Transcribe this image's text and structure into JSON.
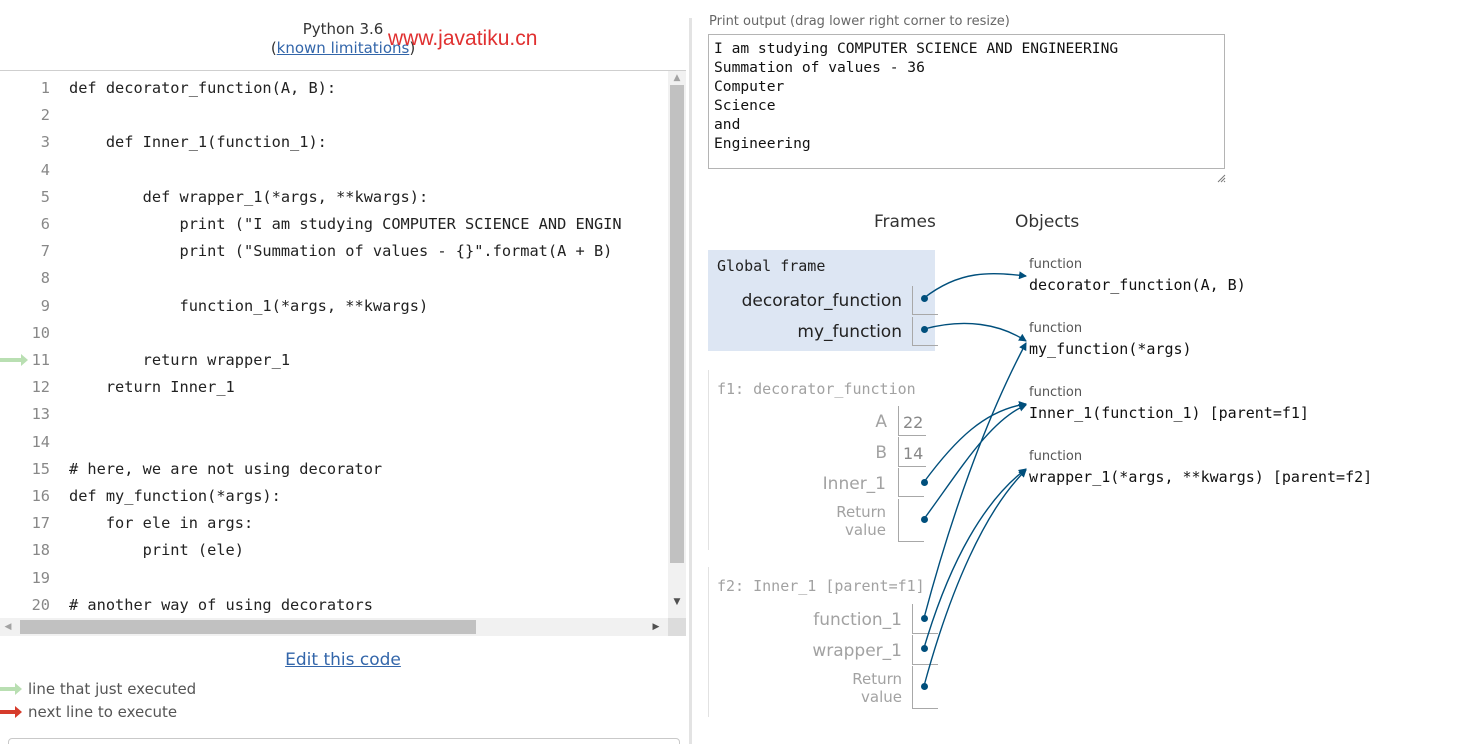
{
  "header": {
    "python_version": "Python 3.6",
    "limitations_open": "(",
    "limitations_link": "known limitations",
    "limitations_close": ")",
    "watermark": "www.javatiku.cn"
  },
  "code": {
    "lines": [
      {
        "num": "1",
        "text": "def decorator_function(A, B):"
      },
      {
        "num": "2",
        "text": ""
      },
      {
        "num": "3",
        "text": "    def Inner_1(function_1):"
      },
      {
        "num": "4",
        "text": ""
      },
      {
        "num": "5",
        "text": "        def wrapper_1(*args, **kwargs):"
      },
      {
        "num": "6",
        "text": "            print (\"I am studying COMPUTER SCIENCE AND ENGIN"
      },
      {
        "num": "7",
        "text": "            print (\"Summation of values - {}\".format(A + B)"
      },
      {
        "num": "8",
        "text": ""
      },
      {
        "num": "9",
        "text": "            function_1(*args, **kwargs)"
      },
      {
        "num": "10",
        "text": ""
      },
      {
        "num": "11",
        "text": "        return wrapper_1"
      },
      {
        "num": "12",
        "text": "    return Inner_1"
      },
      {
        "num": "13",
        "text": ""
      },
      {
        "num": "14",
        "text": ""
      },
      {
        "num": "15",
        "text": "# here, we are not using decorator"
      },
      {
        "num": "16",
        "text": "def my_function(*args):"
      },
      {
        "num": "17",
        "text": "    for ele in args:"
      },
      {
        "num": "18",
        "text": "        print (ele)"
      },
      {
        "num": "19",
        "text": ""
      },
      {
        "num": "20",
        "text": "# another way of using decorators"
      }
    ],
    "just_executed_line": 11
  },
  "edit_link": "Edit this code",
  "legend": {
    "green": "line that just executed",
    "red": "next line to execute"
  },
  "print_output": {
    "caption": "Print output (drag lower right corner to resize)",
    "lines": [
      "I am studying COMPUTER SCIENCE AND ENGINEERING",
      "Summation of values - 36",
      "Computer",
      "Science",
      "and",
      "Engineering"
    ]
  },
  "viz": {
    "frames_heading": "Frames",
    "objects_heading": "Objects",
    "global_frame": {
      "title": "Global frame",
      "vars": [
        "decorator_function",
        "my_function"
      ]
    },
    "f1": {
      "title": "f1: decorator_function",
      "vars": [
        {
          "name": "A",
          "value": "22"
        },
        {
          "name": "B",
          "value": "14"
        },
        {
          "name": "Inner_1",
          "value": ""
        },
        {
          "name_line1": "Return",
          "name_line2": "value"
        }
      ]
    },
    "f2": {
      "title": "f2: Inner_1 [parent=f1]",
      "vars": [
        {
          "name": "function_1"
        },
        {
          "name": "wrapper_1"
        },
        {
          "name_line1": "Return",
          "name_line2": "value"
        }
      ]
    },
    "objects": [
      {
        "type": "function",
        "name": "decorator_function(A, B)"
      },
      {
        "type": "function",
        "name": "my_function(*args)"
      },
      {
        "type": "function",
        "name": "Inner_1(function_1) [parent=f1]"
      },
      {
        "type": "function",
        "name": "wrapper_1(*args, **kwargs) [parent=f2]"
      }
    ]
  },
  "colors": {
    "arrow": "#004f7c",
    "global_frame_bg": "#dde6f3",
    "just_executed_arrow": "#b9dfb2",
    "next_line_arrow": "#d63b2b",
    "link": "#3366aa",
    "watermark": "#e03030"
  }
}
